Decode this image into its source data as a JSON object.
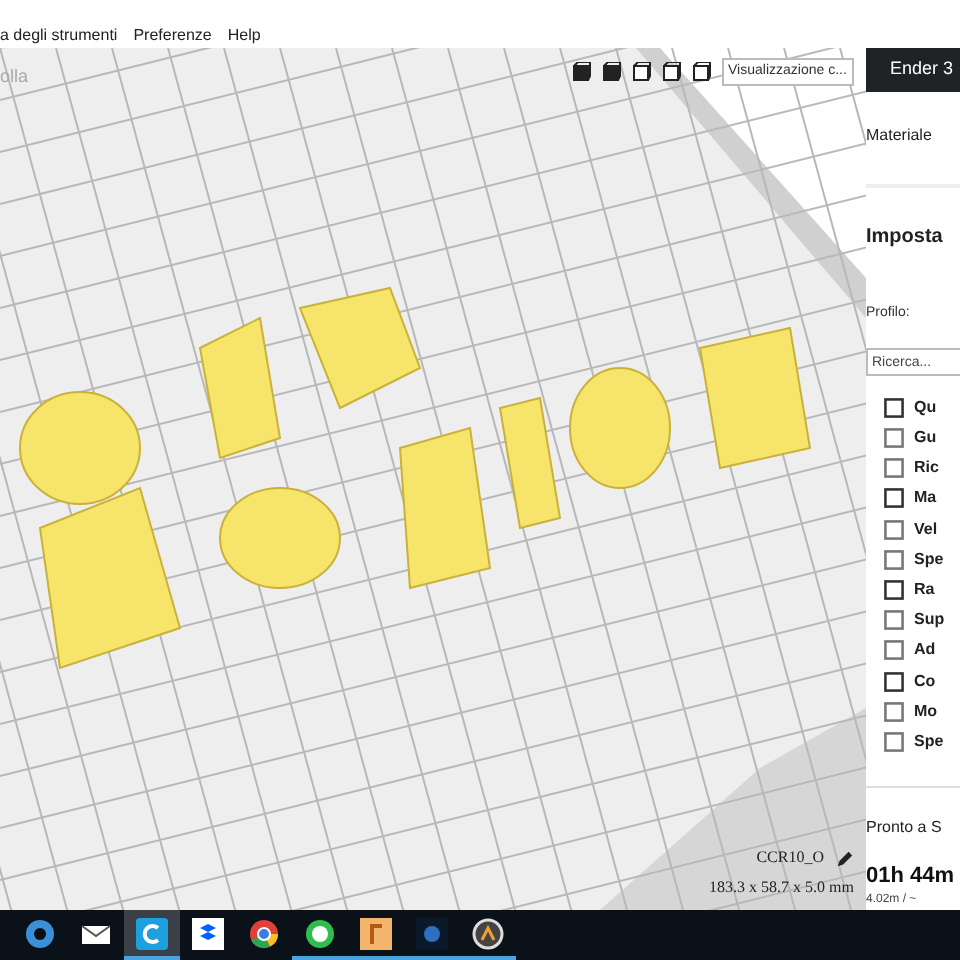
{
  "menu_bar": {
    "items": [
      "a degli strumenti",
      "Preferenze",
      "Help"
    ]
  },
  "viewport": {
    "faded_label": "olla",
    "view_dropdown": "Visualizzazione c...",
    "model_name": "CCR10_O",
    "dimensions": "183.3 x 58.7 x 5.0 mm"
  },
  "printer": {
    "name": "Ender 3"
  },
  "material": {
    "label": "Materiale"
  },
  "settings": {
    "title": "Imposta",
    "profile_label": "Profilo:",
    "search": {
      "placeholder": "Ricerca..."
    },
    "categories": [
      "Qu",
      "Gu",
      "Ric",
      "Ma",
      "Vel",
      "Spe",
      "Ra",
      "Sup",
      "Ad",
      "Co",
      "Mo",
      "Spe"
    ]
  },
  "status": {
    "title": "Pronto a S",
    "time": "01h 44m",
    "detail": "4.02m / ~"
  },
  "taskbar": [
    {
      "kind": "edge",
      "selected": false,
      "running": false
    },
    {
      "kind": "mail",
      "selected": false,
      "running": false
    },
    {
      "kind": "cura",
      "selected": true,
      "running": true
    },
    {
      "kind": "dropbox",
      "selected": false,
      "running": false
    },
    {
      "kind": "chrome",
      "selected": false,
      "running": false
    },
    {
      "kind": "whatsapp",
      "selected": false,
      "running": true
    },
    {
      "kind": "fusion",
      "selected": false,
      "running": true
    },
    {
      "kind": "blender",
      "selected": false,
      "running": true
    },
    {
      "kind": "overwatch",
      "selected": false,
      "running": true
    }
  ]
}
